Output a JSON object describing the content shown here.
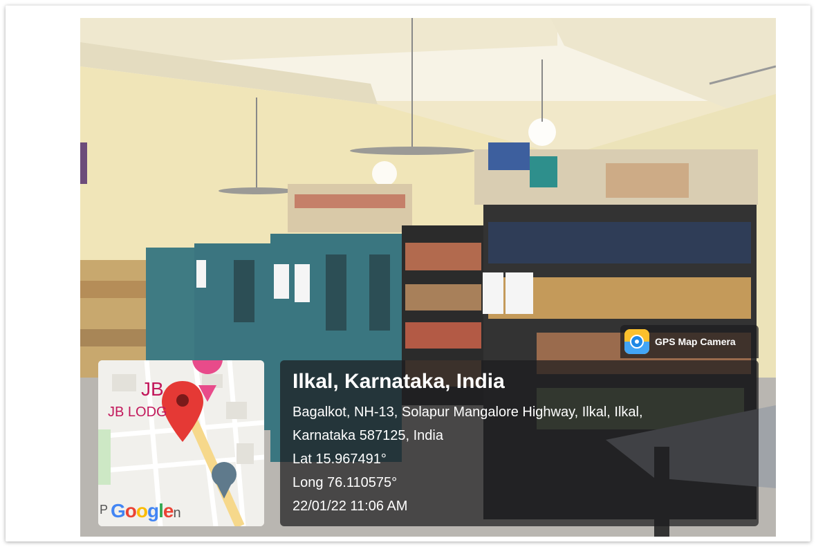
{
  "photo": {
    "subject": "library-interior",
    "icon": "library-photo"
  },
  "map": {
    "label_jb": "JB",
    "label_lodge": "JB LODG",
    "label_station": "P",
    "google_letters": [
      "G",
      "o",
      "o",
      "g",
      "l",
      "e"
    ],
    "google_colors": [
      "#4285F4",
      "#EA4335",
      "#FBBC05",
      "#4285F4",
      "#34A853",
      "#EA4335"
    ],
    "label_station_tail": "n",
    "pin_color": "#e53935"
  },
  "badge": {
    "label": "GPS Map Camera",
    "icon": "gps-map-camera-icon"
  },
  "location": {
    "title": "Ilkal, Karnataka, India",
    "address_line1": "Bagalkot, NH-13, Solapur Mangalore Highway, Ilkal, Ilkal,",
    "address_line2": "Karnataka 587125, India",
    "lat": "Lat 15.967491°",
    "long": "Long 76.110575°",
    "datetime": "22/01/22 11:06 AM"
  }
}
